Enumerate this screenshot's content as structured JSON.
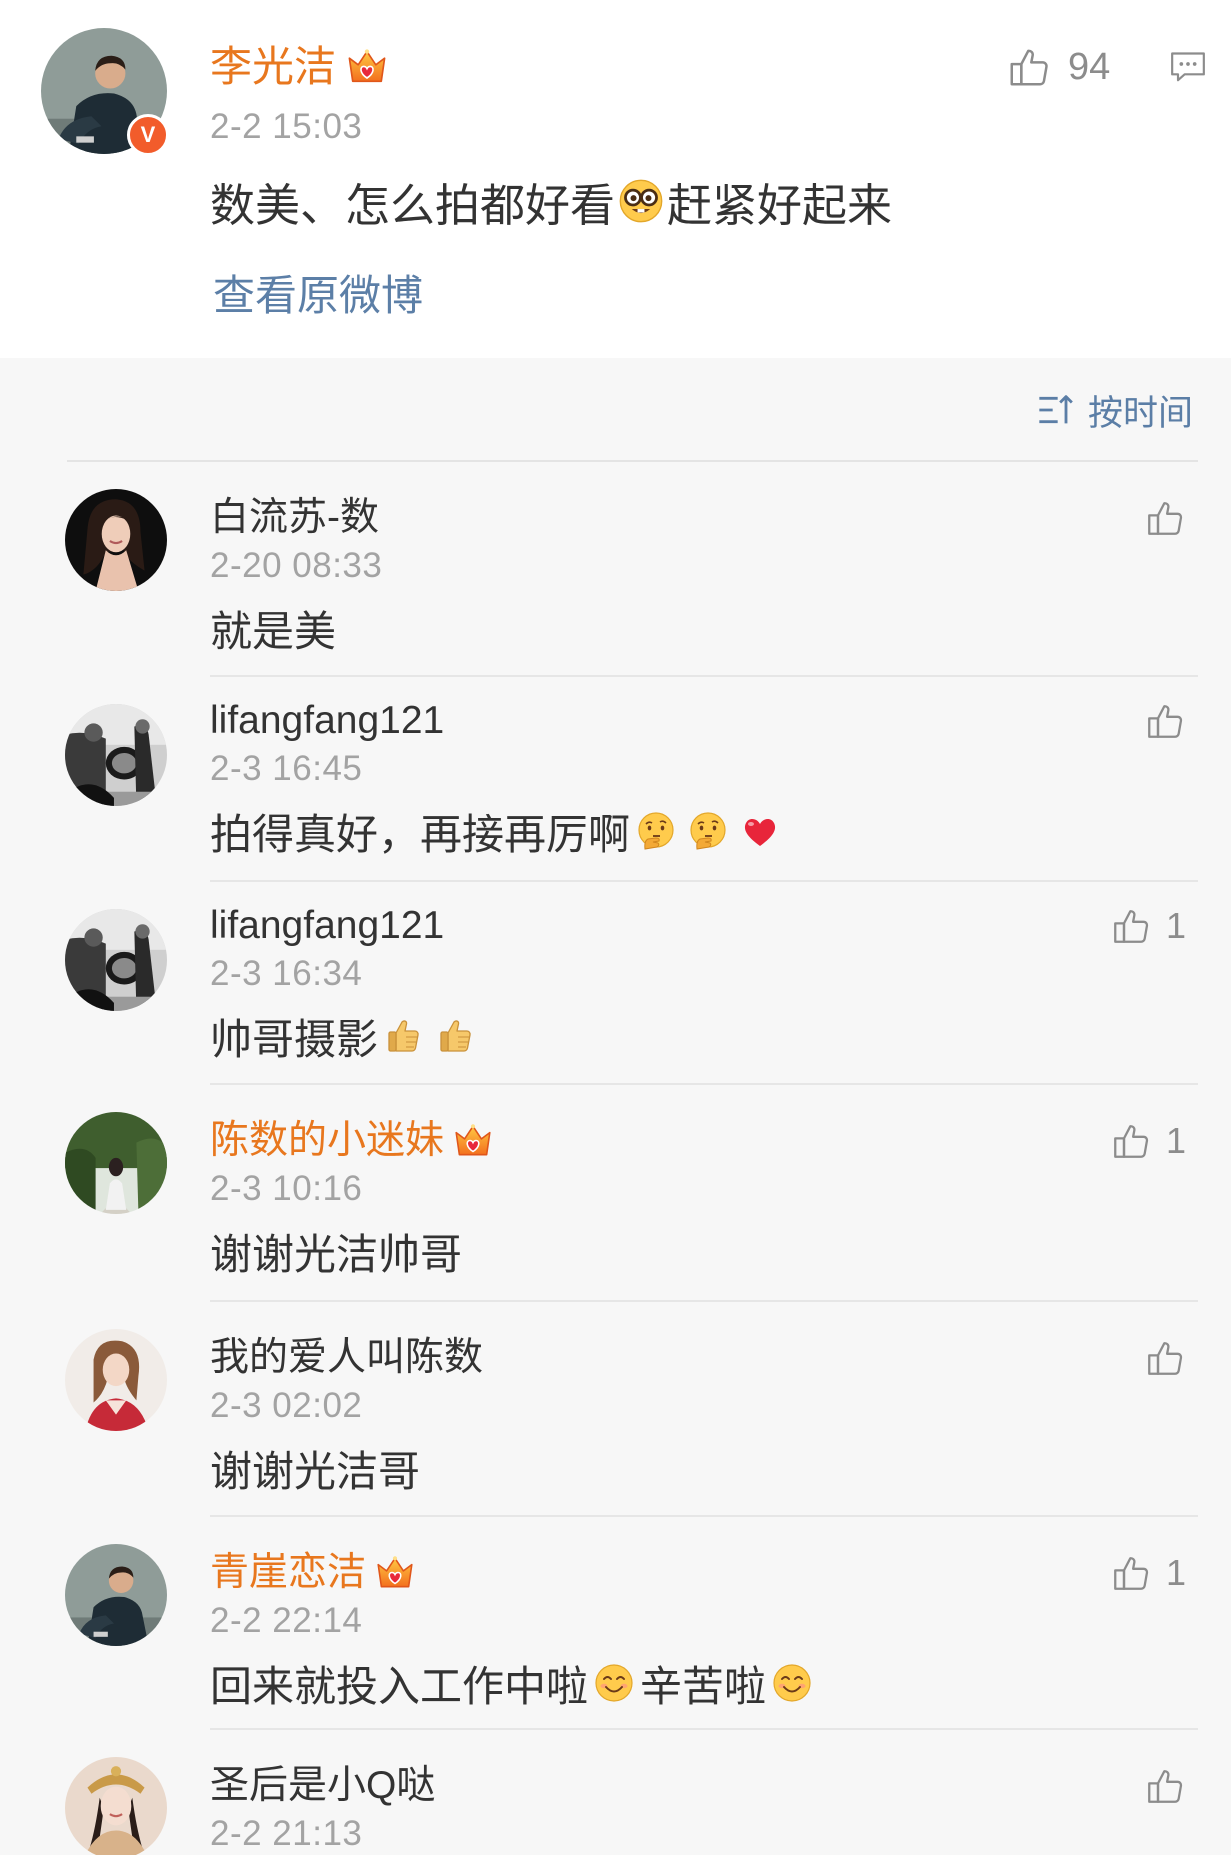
{
  "post": {
    "author": "李光洁",
    "member_badge_icon": "crown-icon",
    "verified_badge_label": "V",
    "time": "2-2 15:03",
    "content": [
      {
        "text": "数美、怎么拍都好看"
      },
      {
        "emoji": "nerd-face-emoji"
      },
      {
        "text": "赶紧好起来"
      }
    ],
    "like_icon": "thumbs-up-icon",
    "like_count": "94",
    "comment_icon": "comment-icon",
    "view_original_label": "查看原微博"
  },
  "comments_header": {
    "sort_icon": "sort-icon",
    "sort_label": "按时间"
  },
  "comments": [
    {
      "author": "白流苏-数",
      "member": false,
      "time": "2-20 08:33",
      "content": [
        {
          "text": "就是美"
        }
      ]
    },
    {
      "author": "lifangfang121",
      "member": false,
      "time": "2-3 16:45",
      "content": [
        {
          "text": "拍得真好，再接再厉啊"
        },
        {
          "emoji": "thinking-emoji"
        },
        {
          "emoji": "thinking-emoji"
        },
        {
          "emoji": "heart-emoji"
        }
      ]
    },
    {
      "author": "lifangfang121",
      "member": false,
      "time": "2-3 16:34",
      "content": [
        {
          "text": "帅哥摄影"
        },
        {
          "emoji": "thumbs-up-emoji"
        },
        {
          "emoji": "thumbs-up-emoji"
        }
      ],
      "like_count": "1"
    },
    {
      "author": "陈数的小迷妹",
      "member": true,
      "time": "2-3 10:16",
      "content": [
        {
          "text": "谢谢光洁帅哥"
        }
      ],
      "like_count": "1"
    },
    {
      "author": "我的爱人叫陈数",
      "member": false,
      "time": "2-3 02:02",
      "content": [
        {
          "text": "谢谢光洁哥"
        }
      ]
    },
    {
      "author": "青崖恋洁",
      "member": true,
      "time": "2-2 22:14",
      "content": [
        {
          "text": "回来就投入工作中啦"
        },
        {
          "emoji": "smile-emoji"
        },
        {
          "text": "辛苦啦"
        },
        {
          "emoji": "smile-emoji"
        }
      ],
      "like_count": "1"
    },
    {
      "author": "圣后是小Q哒",
      "member": false,
      "time": "2-2 21:13",
      "content": []
    }
  ],
  "colors": {
    "member_name": "#e8771e",
    "link": "#5c7fa7",
    "verified_badge": "#f25c2b",
    "timestamp": "#a3a3a3",
    "icon_gray": "#8c8c8c",
    "page_background": "#f7f7f7",
    "card_background": "#ffffff"
  }
}
